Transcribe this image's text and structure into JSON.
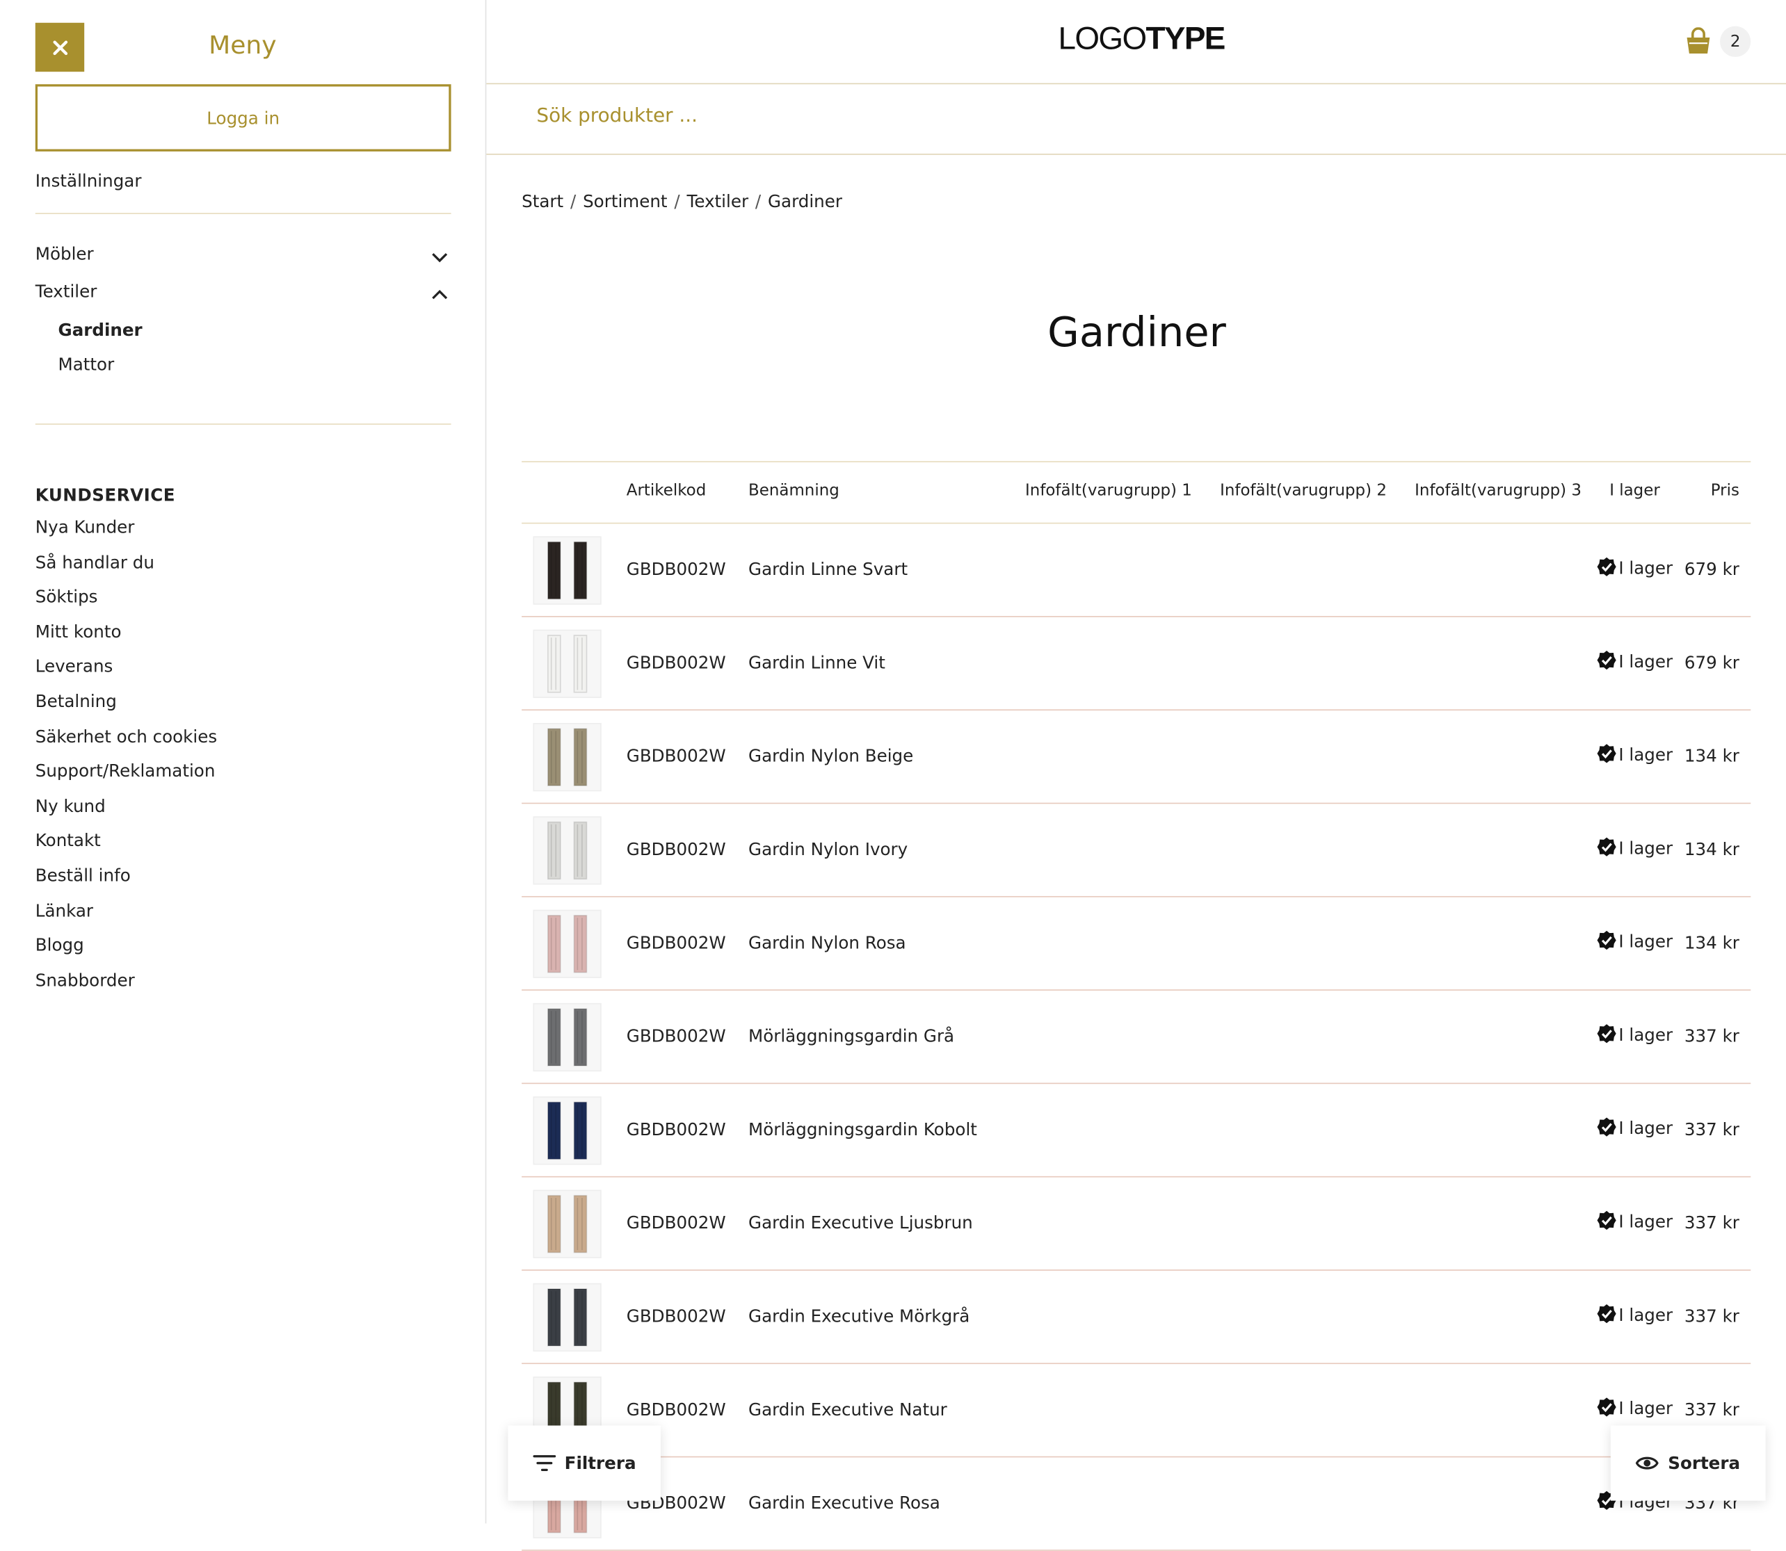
{
  "sidebar": {
    "title": "Meny",
    "login_label": "Logga in",
    "settings_label": "Inställningar",
    "categories": [
      {
        "label": "Möbler",
        "expanded": false
      },
      {
        "label": "Textiler",
        "expanded": true,
        "children": [
          "Gardiner",
          "Mattor"
        ],
        "active_child": "Gardiner"
      }
    ],
    "kundservice": {
      "title": "KUNDSERVICE",
      "links": [
        "Nya Kunder",
        "Så handlar du",
        "Söktips",
        "Mitt konto",
        "Leverans",
        "Betalning",
        "Säkerhet och cookies",
        "Support/Reklamation",
        "Ny kund",
        "Kontakt",
        "Beställ info",
        "Länkar",
        "Blogg",
        "Snabborder"
      ]
    }
  },
  "header": {
    "logo_light": "LOGO",
    "logo_bold": "TYPE",
    "cart_count": "2"
  },
  "search": {
    "placeholder": "Sök produkter ..."
  },
  "breadcrumb": [
    "Start",
    "Sortiment",
    "Textiler",
    "Gardiner"
  ],
  "page_title": "Gardiner",
  "table": {
    "columns": [
      "",
      "Artikelkod",
      "Benämning",
      "Infofält(varugrupp) 1",
      "Infofält(varugrupp) 2",
      "Infofält(varugrupp) 3",
      "I lager",
      "Pris"
    ],
    "rows": [
      {
        "code": "GBDB002W",
        "name": "Gardin Linne Svart",
        "stock": "I lager",
        "price": "679 kr",
        "swatch": "#2b2522"
      },
      {
        "code": "GBDB002W",
        "name": "Gardin Linne Vit",
        "stock": "I lager",
        "price": "679 kr",
        "swatch": "#f2f2f0"
      },
      {
        "code": "GBDB002W",
        "name": "Gardin Nylon Beige",
        "stock": "I lager",
        "price": "134 kr",
        "swatch": "#9a8f74"
      },
      {
        "code": "GBDB002W",
        "name": "Gardin Nylon Ivory",
        "stock": "I lager",
        "price": "134 kr",
        "swatch": "#d9d9d6"
      },
      {
        "code": "GBDB002W",
        "name": "Gardin Nylon Rosa",
        "stock": "I lager",
        "price": "134 kr",
        "swatch": "#d9b3b0"
      },
      {
        "code": "GBDB002W",
        "name": "Mörläggningsgardin Grå",
        "stock": "I lager",
        "price": "337 kr",
        "swatch": "#6d6e70"
      },
      {
        "code": "GBDB002W",
        "name": "Mörläggningsgardin Kobolt",
        "stock": "I lager",
        "price": "337 kr",
        "swatch": "#1c2c55"
      },
      {
        "code": "GBDB002W",
        "name": "Gardin Executive Ljusbrun",
        "stock": "I lager",
        "price": "337 kr",
        "swatch": "#c9aa8c"
      },
      {
        "code": "GBDB002W",
        "name": "Gardin Executive Mörkgrå",
        "stock": "I lager",
        "price": "337 kr",
        "swatch": "#3b3f45"
      },
      {
        "code": "GBDB002W",
        "name": "Gardin Executive Natur",
        "stock": "I lager",
        "price": "337 kr",
        "swatch": "#3a3b2c"
      },
      {
        "code": "GBDB002W",
        "name": "Gardin Executive Rosa",
        "stock": "I lager",
        "price": "337 kr",
        "swatch": "#d8a8a0"
      }
    ]
  },
  "buttons": {
    "filter_label": "Filtrera",
    "sort_label": "Sortera"
  },
  "colors": {
    "accent": "#a8902e",
    "divider": "#e7dcbf"
  }
}
